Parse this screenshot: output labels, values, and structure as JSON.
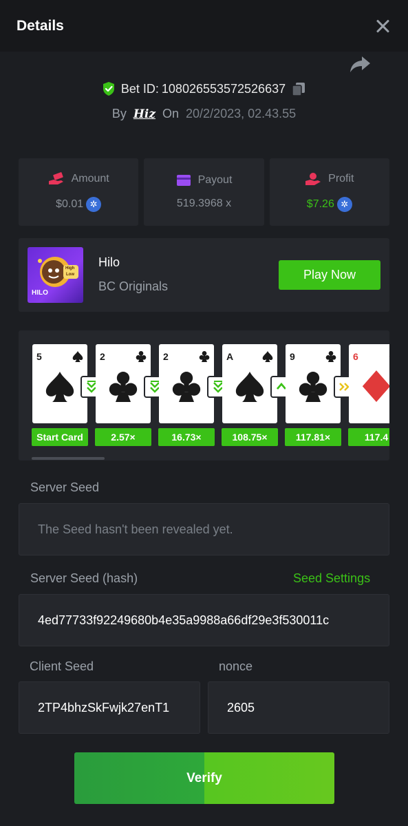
{
  "header": {
    "title": "Details"
  },
  "bet": {
    "id_label": "Bet ID:",
    "id": "108026553572526637",
    "by_label": "By",
    "user": "Hiz",
    "on_label": "On",
    "date": "20/2/2023, 02.43.55"
  },
  "stats": [
    {
      "label": "Amount",
      "value": "$0.01",
      "icon": "money-hand-icon",
      "value_color": "#8a9098"
    },
    {
      "label": "Payout",
      "value": "519.3968 x",
      "icon": "card-icon"
    },
    {
      "label": "Profit",
      "value": "$7.26",
      "icon": "profit-hand-icon",
      "value_color": "#3bc117"
    }
  ],
  "game": {
    "name": "Hilo",
    "provider": "BC Originals",
    "thumb_label": "HILO",
    "thumb_badge_top": "High",
    "thumb_badge_bottom": "Low",
    "play_label": "Play Now"
  },
  "cards": [
    {
      "rank": "5",
      "suit": "spade",
      "red": false,
      "multiplier": "Start Card",
      "arrow": "down"
    },
    {
      "rank": "2",
      "suit": "club",
      "red": false,
      "multiplier": "2.57×",
      "arrow": "down"
    },
    {
      "rank": "2",
      "suit": "club",
      "red": false,
      "multiplier": "16.73×",
      "arrow": "down"
    },
    {
      "rank": "A",
      "suit": "spade",
      "red": false,
      "multiplier": "108.75×",
      "arrow": "up"
    },
    {
      "rank": "9",
      "suit": "club",
      "red": false,
      "multiplier": "117.81×",
      "arrow": "skip"
    },
    {
      "rank": "6",
      "suit": "diamond",
      "red": true,
      "multiplier": "117.4",
      "arrow": ""
    }
  ],
  "server_seed": {
    "label": "Server Seed",
    "value": "The Seed hasn't been revealed yet."
  },
  "server_hash": {
    "label": "Server Seed (hash)",
    "link": "Seed Settings",
    "value": "4ed77733f92249680b4e35a9988a66df29e3f530011c"
  },
  "client_seed": {
    "label": "Client Seed",
    "value": "2TP4bhzSkFwjk27enT1"
  },
  "nonce": {
    "label": "nonce",
    "value": "2605"
  },
  "verify_label": "Verify",
  "colors": {
    "accent": "#3bc117",
    "background": "#1c1e22",
    "panel": "#25272c"
  }
}
